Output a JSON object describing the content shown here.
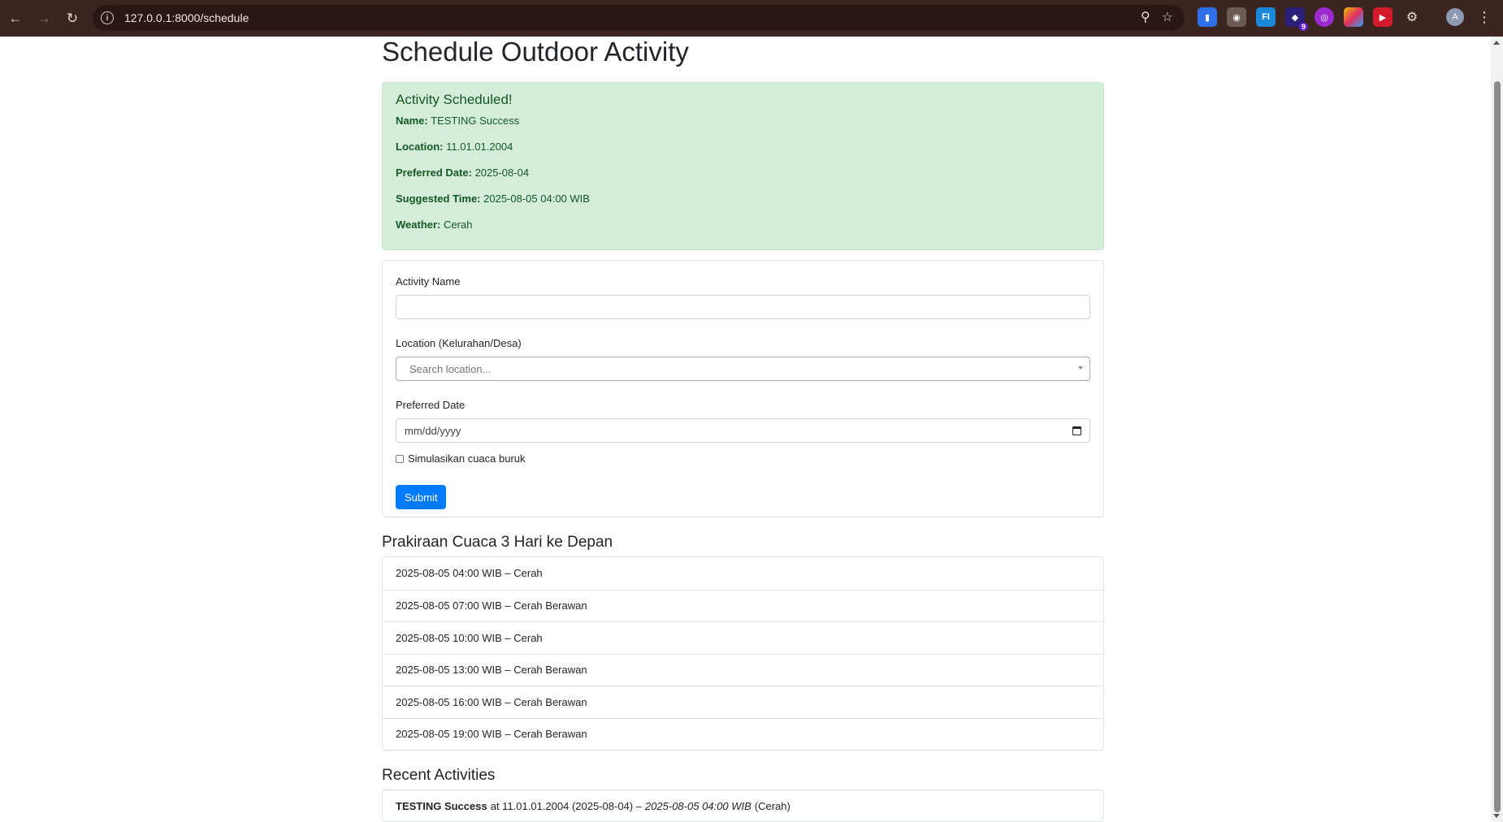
{
  "browser": {
    "url": "127.0.0.1:8000/schedule",
    "extension_badge": "9",
    "profile_initial": "A"
  },
  "page": {
    "title": "Schedule Outdoor Activity"
  },
  "alert": {
    "heading": "Activity Scheduled!",
    "fields": [
      {
        "label": "Name:",
        "value": "TESTING Success"
      },
      {
        "label": "Location:",
        "value": "11.01.01.2004"
      },
      {
        "label": "Preferred Date:",
        "value": "2025-08-04"
      },
      {
        "label": "Suggested Time:",
        "value": "2025-08-05 04:00 WIB"
      },
      {
        "label": "Weather:",
        "value": "Cerah"
      }
    ]
  },
  "form": {
    "activity_name_label": "Activity Name",
    "activity_name_value": "",
    "location_label": "Location (Kelurahan/Desa)",
    "location_placeholder": "Search location...",
    "date_label": "Preferred Date",
    "date_placeholder": "mm/dd/yyyy",
    "simulate_label": "Simulasikan cuaca buruk",
    "simulate_checked": false,
    "submit_label": "Submit"
  },
  "forecast": {
    "title": "Prakiraan Cuaca 3 Hari ke Depan",
    "items": [
      "2025-08-05 04:00 WIB – Cerah",
      "2025-08-05 07:00 WIB – Cerah Berawan",
      "2025-08-05 10:00 WIB – Cerah",
      "2025-08-05 13:00 WIB – Cerah Berawan",
      "2025-08-05 16:00 WIB – Cerah Berawan",
      "2025-08-05 19:00 WIB – Cerah Berawan"
    ]
  },
  "recent": {
    "title": "Recent Activities",
    "items": [
      {
        "name": "TESTING Success",
        "at_text": "at 11.01.01.2004 (2025-08-04) –",
        "time": "2025-08-05 04:00 WIB",
        "weather": "(Cerah)"
      }
    ]
  },
  "colors": {
    "chrome": "#3c2421",
    "success_bg": "#d4edda",
    "success_text": "#155724",
    "primary": "#007bff"
  }
}
